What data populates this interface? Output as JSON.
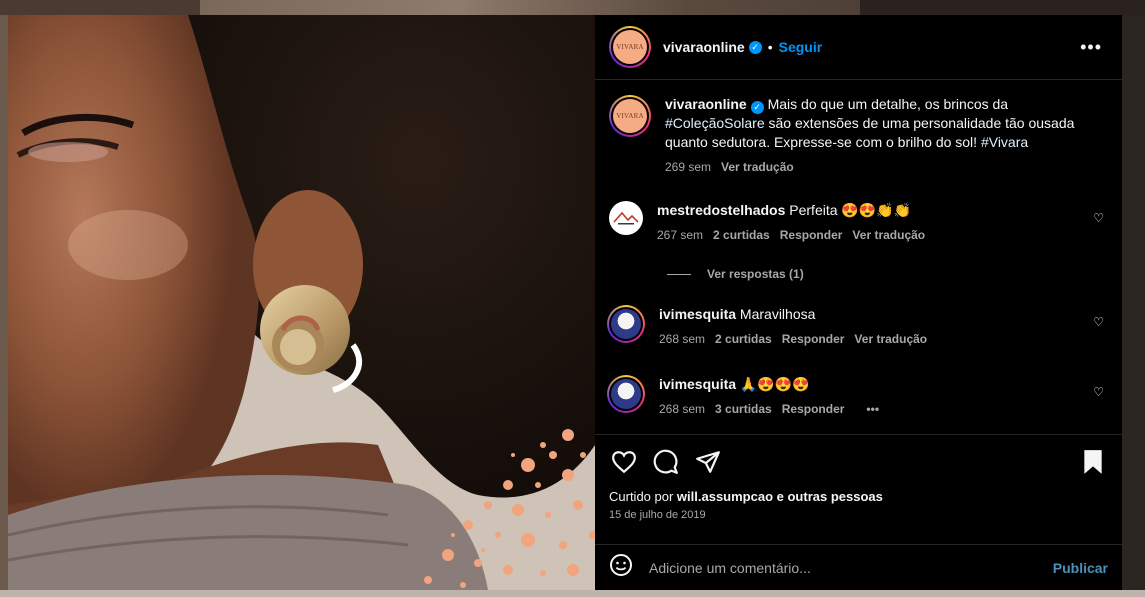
{
  "post": {
    "author": "vivaraonline",
    "brand_avatar_text": "VIVARA",
    "follow_label": "Seguir",
    "separator": "•",
    "more_label": "•••"
  },
  "caption": {
    "author": "vivaraonline",
    "text_before": " Mais do que um detalhe, os brincos da ",
    "hashtag1": "#ColeçãoSolare",
    "text_middle": " são extensões de uma personalidade tão ousada quanto sedutora. Expresse-se com o brilho do sol! ",
    "hashtag2": "#Vivara",
    "time": "269 sem",
    "translate": "Ver tradução"
  },
  "comments": [
    {
      "author": "mestredostelhados",
      "text": "Perfeita 😍😍👏👏",
      "time": "267 sem",
      "likes": "2 curtidas",
      "reply": "Responder",
      "translate": "Ver tradução",
      "view_replies": "Ver respostas (1)"
    },
    {
      "author": "ivimesquita",
      "text": "Maravilhosa",
      "time": "268 sem",
      "likes": "2 curtidas",
      "reply": "Responder",
      "translate": "Ver tradução"
    },
    {
      "author": "ivimesquita",
      "text": "🙏😍😍😍",
      "time": "268 sem",
      "likes": "3 curtidas",
      "reply": "Responder",
      "more": "•••"
    }
  ],
  "likes_summary": {
    "prefix": "Curtido por ",
    "user": "will.assumpcao",
    "suffix": " e ",
    "others": "outras pessoas"
  },
  "date": "15 de julho de 2019",
  "comment_box": {
    "placeholder": "Adicione um comentário...",
    "publish_label": "Publicar"
  },
  "colors": {
    "accent": "#0095f6",
    "panel_bg": "#000000",
    "muted": "#a8a8a8",
    "publish": "#4c8fb8"
  },
  "icons": [
    "heart-icon",
    "comment-icon",
    "share-icon",
    "bookmark-icon",
    "emoji-icon",
    "verified-icon",
    "more-icon"
  ]
}
